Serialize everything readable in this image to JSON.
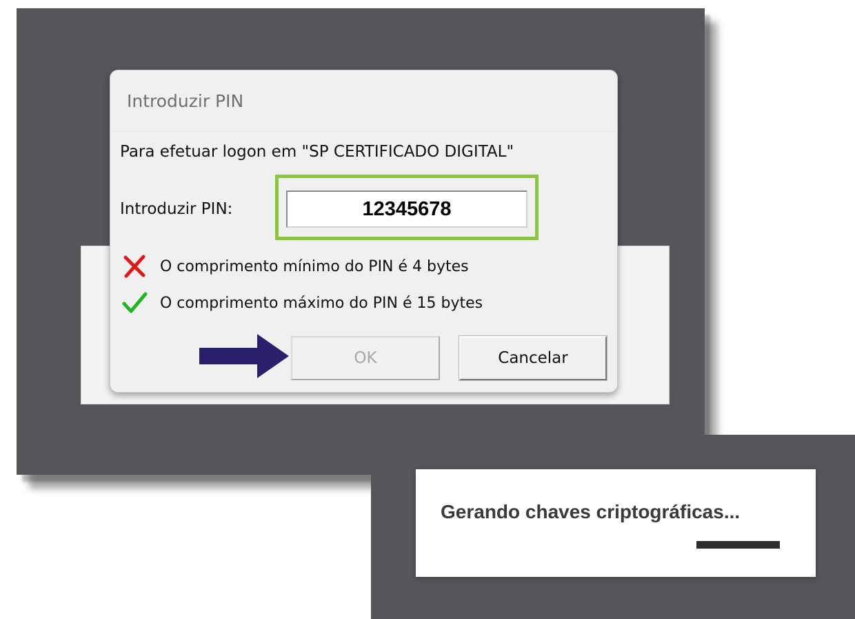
{
  "dialog": {
    "title": "Introduzir PIN",
    "logon_text": "Para efetuar logon em \"SP CERTIFICADO DIGITAL\"",
    "pin_label": "Introduzir PIN:",
    "pin_value": "12345678",
    "rules": [
      {
        "icon": "red-x-icon",
        "text": "O comprimento mínimo do PIN é 4 bytes"
      },
      {
        "icon": "green-check-icon",
        "text": "O comprimento máximo do PIN é 15 bytes"
      }
    ],
    "ok_label": "OK",
    "cancel_label": "Cancelar"
  },
  "toast": {
    "message": "Gerando chaves criptográficas...",
    "progress": 1.0
  },
  "colors": {
    "highlight_border": "#8cc63f",
    "arrow": "#2a1f6b",
    "backdrop": "#55555a"
  }
}
